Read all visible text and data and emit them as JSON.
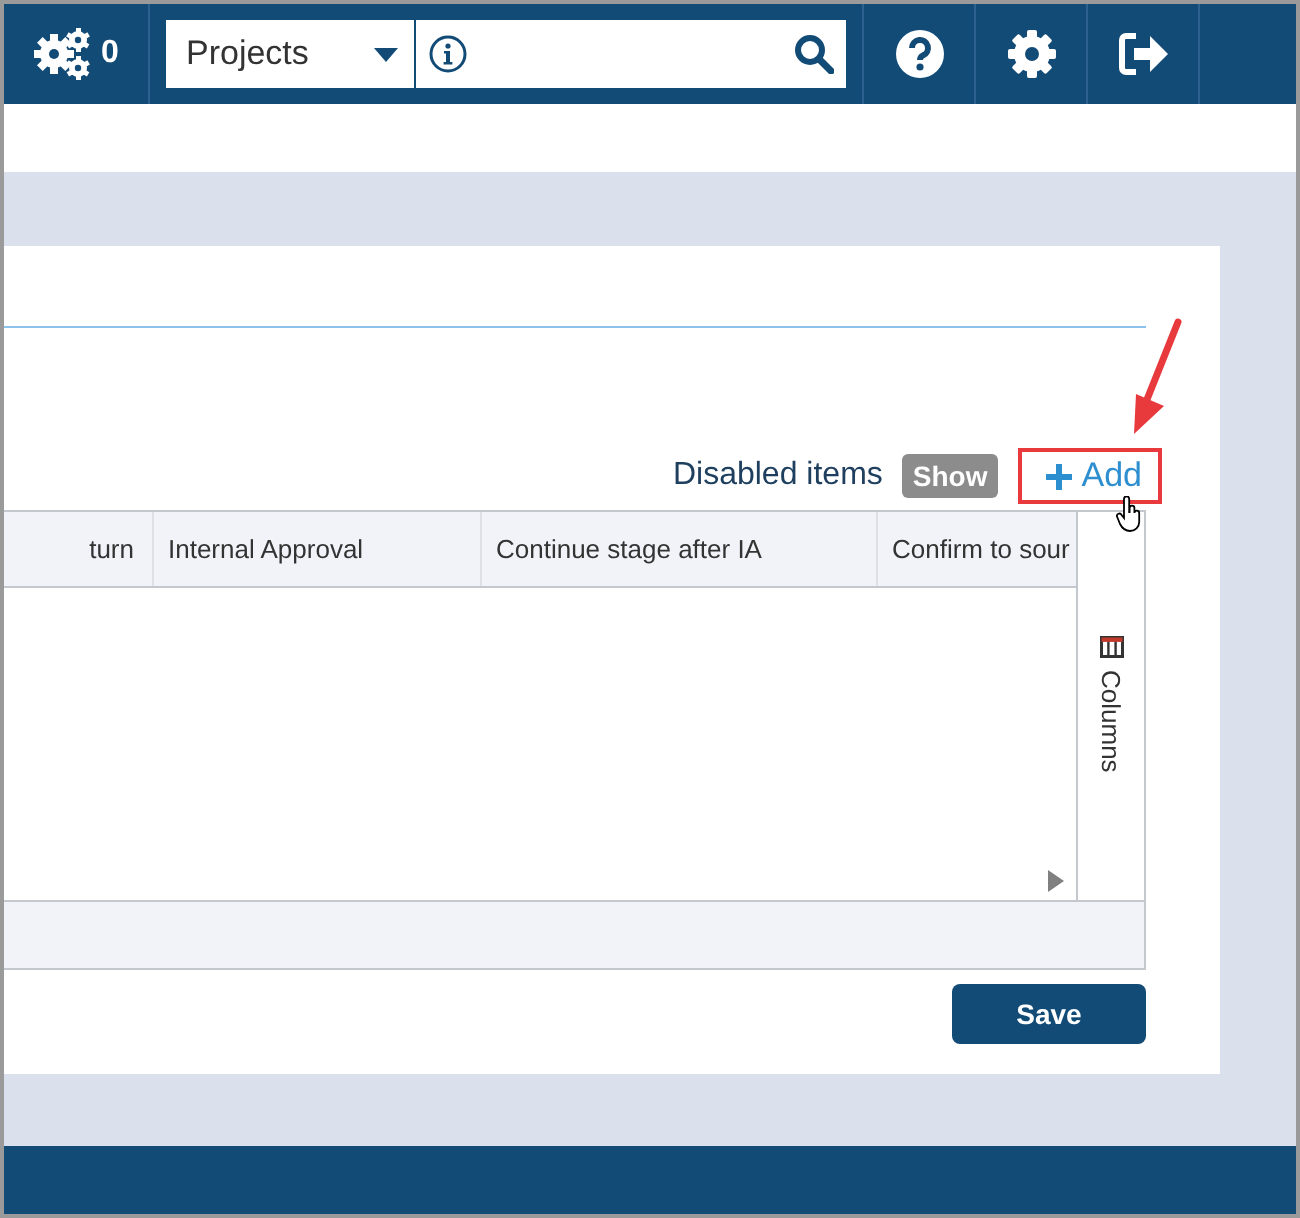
{
  "top_bar": {
    "jobs_count": "0",
    "search_scope": "Projects"
  },
  "toolbar": {
    "disabled_items_label": "Disabled items",
    "show_button": "Show",
    "add_button": "Add",
    "add_highlighted": true
  },
  "table": {
    "columns": [
      "turn",
      "Internal Approval",
      "Continue stage after IA",
      "Confirm to sour"
    ],
    "columns_panel": "Columns"
  },
  "buttons": {
    "save": "Save"
  }
}
